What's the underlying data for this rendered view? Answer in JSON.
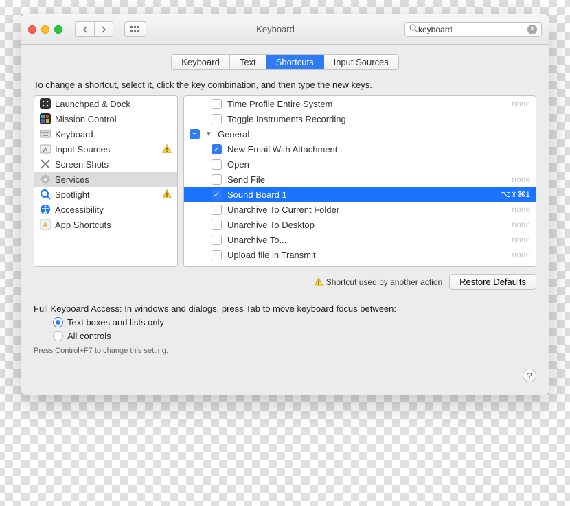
{
  "window": {
    "title": "Keyboard",
    "search_value": "keyboard"
  },
  "tabs": {
    "items": [
      "Keyboard",
      "Text",
      "Shortcuts",
      "Input Sources"
    ],
    "active_index": 2
  },
  "intro": "To change a shortcut, select it, click the key combination, and then type the new keys.",
  "categories": [
    {
      "label": "Launchpad & Dock",
      "icon": "launchpad",
      "warn": false,
      "selected": false
    },
    {
      "label": "Mission Control",
      "icon": "mission",
      "warn": false,
      "selected": false
    },
    {
      "label": "Keyboard",
      "icon": "keyboard",
      "warn": false,
      "selected": false
    },
    {
      "label": "Input Sources",
      "icon": "input",
      "warn": true,
      "selected": false
    },
    {
      "label": "Screen Shots",
      "icon": "screenshot",
      "warn": false,
      "selected": false
    },
    {
      "label": "Services",
      "icon": "gear",
      "warn": false,
      "selected": true
    },
    {
      "label": "Spotlight",
      "icon": "spotlight",
      "warn": true,
      "selected": false
    },
    {
      "label": "Accessibility",
      "icon": "accessibility",
      "warn": false,
      "selected": false
    },
    {
      "label": "App Shortcuts",
      "icon": "appshortcuts",
      "warn": false,
      "selected": false
    }
  ],
  "actions": [
    {
      "type": "item",
      "label": "Time Profile Entire System",
      "checked": false,
      "shortcut": "none",
      "shortcut_dim": true,
      "indent": 2
    },
    {
      "type": "item",
      "label": "Toggle Instruments Recording",
      "checked": false,
      "shortcut": "",
      "indent": 2
    },
    {
      "type": "group",
      "label": "General",
      "state": "minus",
      "expanded": true
    },
    {
      "type": "item",
      "label": "New Email With Attachment",
      "checked": true,
      "shortcut": "",
      "indent": 2
    },
    {
      "type": "item",
      "label": "Open",
      "checked": false,
      "shortcut": "",
      "indent": 2
    },
    {
      "type": "item",
      "label": "Send File",
      "checked": false,
      "shortcut": "none",
      "shortcut_dim": true,
      "indent": 2
    },
    {
      "type": "item",
      "label": "Sound Board 1",
      "checked": true,
      "shortcut": "⌥⇧⌘1",
      "indent": 2,
      "selected": true
    },
    {
      "type": "item",
      "label": "Unarchive To Current Folder",
      "checked": false,
      "shortcut": "none",
      "shortcut_dim": true,
      "indent": 2
    },
    {
      "type": "item",
      "label": "Unarchive To Desktop",
      "checked": false,
      "shortcut": "none",
      "shortcut_dim": true,
      "indent": 2
    },
    {
      "type": "item",
      "label": "Unarchive To...",
      "checked": false,
      "shortcut": "none",
      "shortcut_dim": true,
      "indent": 2
    },
    {
      "type": "item",
      "label": "Upload file in Transmit",
      "checked": false,
      "shortcut": "none",
      "shortcut_dim": true,
      "indent": 2
    }
  ],
  "warning_text": "Shortcut used by another action",
  "restore_label": "Restore Defaults",
  "full_keyboard": {
    "heading": "Full Keyboard Access: In windows and dialogs, press Tab to move keyboard focus between:",
    "option_a": "Text boxes and lists only",
    "option_b": "All controls",
    "selected": 0,
    "hint": "Press Control+F7 to change this setting."
  }
}
